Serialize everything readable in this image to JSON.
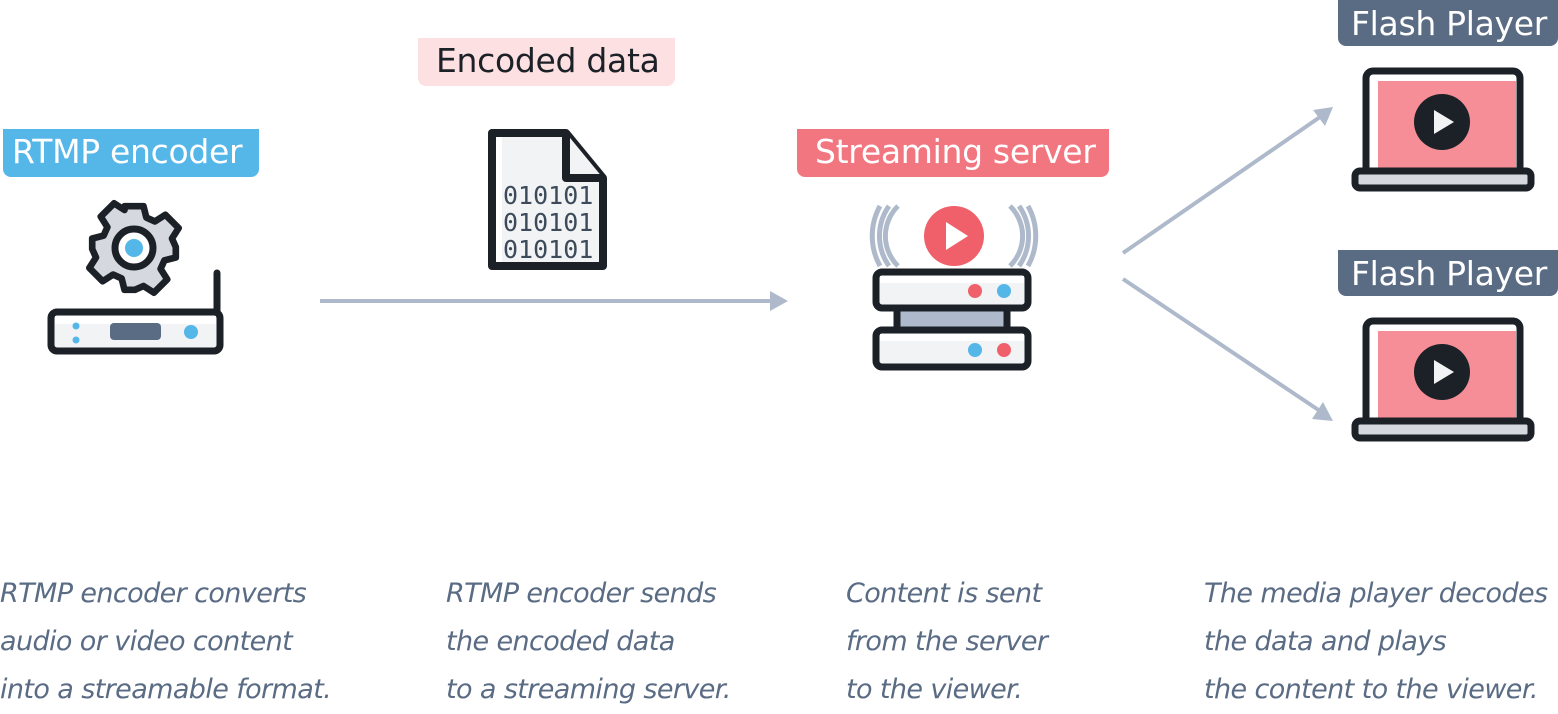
{
  "diagram": {
    "nodes": [
      {
        "id": "encoder",
        "label": "RTMP encoder",
        "icon": "gear-router-icon",
        "color": "#55b6e8"
      },
      {
        "id": "encoded-data",
        "label": "Encoded data",
        "icon": "binary-file-icon",
        "color": "#fde0e2",
        "file_lines": [
          "010101",
          "010101",
          "010101"
        ]
      },
      {
        "id": "server",
        "label": "Streaming server",
        "icon": "streaming-server-icon",
        "color": "#f27680"
      },
      {
        "id": "player-1",
        "label": "Flash Player",
        "icon": "laptop-play-icon",
        "color": "#5a6b84"
      },
      {
        "id": "player-2",
        "label": "Flash Player",
        "icon": "laptop-play-icon",
        "color": "#5a6b84"
      }
    ],
    "edges": [
      {
        "from": "encoder",
        "to": "server"
      },
      {
        "from": "server",
        "to": "player-1"
      },
      {
        "from": "server",
        "to": "player-2"
      }
    ],
    "arrow_color": "#aebacb"
  },
  "captions": [
    {
      "lines": [
        "RTMP encoder converts",
        "audio or video content",
        "into a streamable format."
      ]
    },
    {
      "lines": [
        "RTMP encoder sends",
        "the encoded data",
        "to a streaming server."
      ]
    },
    {
      "lines": [
        "Content is sent",
        "from the server",
        "to the viewer."
      ]
    },
    {
      "lines": [
        "The media player decodes",
        "the data and plays",
        "the content to the viewer."
      ]
    }
  ]
}
